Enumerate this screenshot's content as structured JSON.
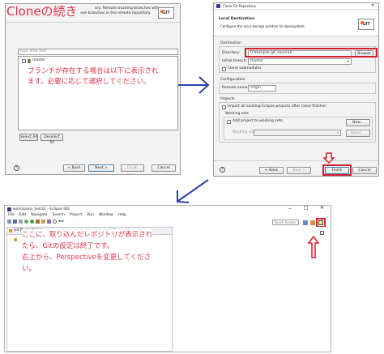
{
  "annotation_top_left": "Cloneの続き",
  "annotation_branch": [
    "ブランチが存在する場合は以下に表示され",
    "ます。必要に応じて選択してください。"
  ],
  "annotation_ide": [
    "ここに、取り込んだレポジトリが表示され",
    "たら、Gitの設定は終了です。",
    "右上から、Perspectiveを変更してくださ",
    "い。"
  ],
  "colors": {
    "annotation": "#e0334a",
    "red_box": "#d61f2c",
    "arrow": "#2c3fa8"
  },
  "branch_dialog": {
    "description_line1": "ory. Remote tracking branches will",
    "description_line2": "be created to track updates for these branches in the remote repository.",
    "filter_placeholder": "type filter text",
    "branch_items": [
      "master"
    ],
    "select_all": "Select All",
    "deselect_all": "Deselect All",
    "back": "< Back",
    "next": "Next >",
    "finish": "Finish",
    "cancel": "Cancel",
    "help_icon": "help-icon"
  },
  "dest_dialog": {
    "title": "Clone Git Repository",
    "heading": "Local Destination",
    "subheading": "Configure the local storage location for basesystem.",
    "destination_group": "Destination",
    "directory_label": "Directory:",
    "directory_value": "D:¥eclipse-git_source¥",
    "browse": "Browse",
    "initial_branch_label": "Initial branch:",
    "initial_branch_value": "master",
    "clone_submodules": "Clone submodules",
    "configuration_group": "Configuration",
    "remote_name_label": "Remote name:",
    "remote_name_value": "origin",
    "projects_group": "Projects",
    "import_projects": "Import all existing Eclipse projects after clone finishes",
    "working_sets_group": "Working sets",
    "add_working_sets": "Add project to working sets",
    "working_sets_label": "Working sets:",
    "new": "New...",
    "select": "Select...",
    "back": "< Back",
    "next": "Next >",
    "finish": "Finish",
    "cancel": "Cancel"
  },
  "ide": {
    "title": "workspace_test32 - Eclipse IDE",
    "menu": [
      "File",
      "Edit",
      "Navigate",
      "Search",
      "Project",
      "Run",
      "Window",
      "Help"
    ],
    "git_repositories_tab": "Git Repositories",
    "quick_access": "Quick Access"
  }
}
